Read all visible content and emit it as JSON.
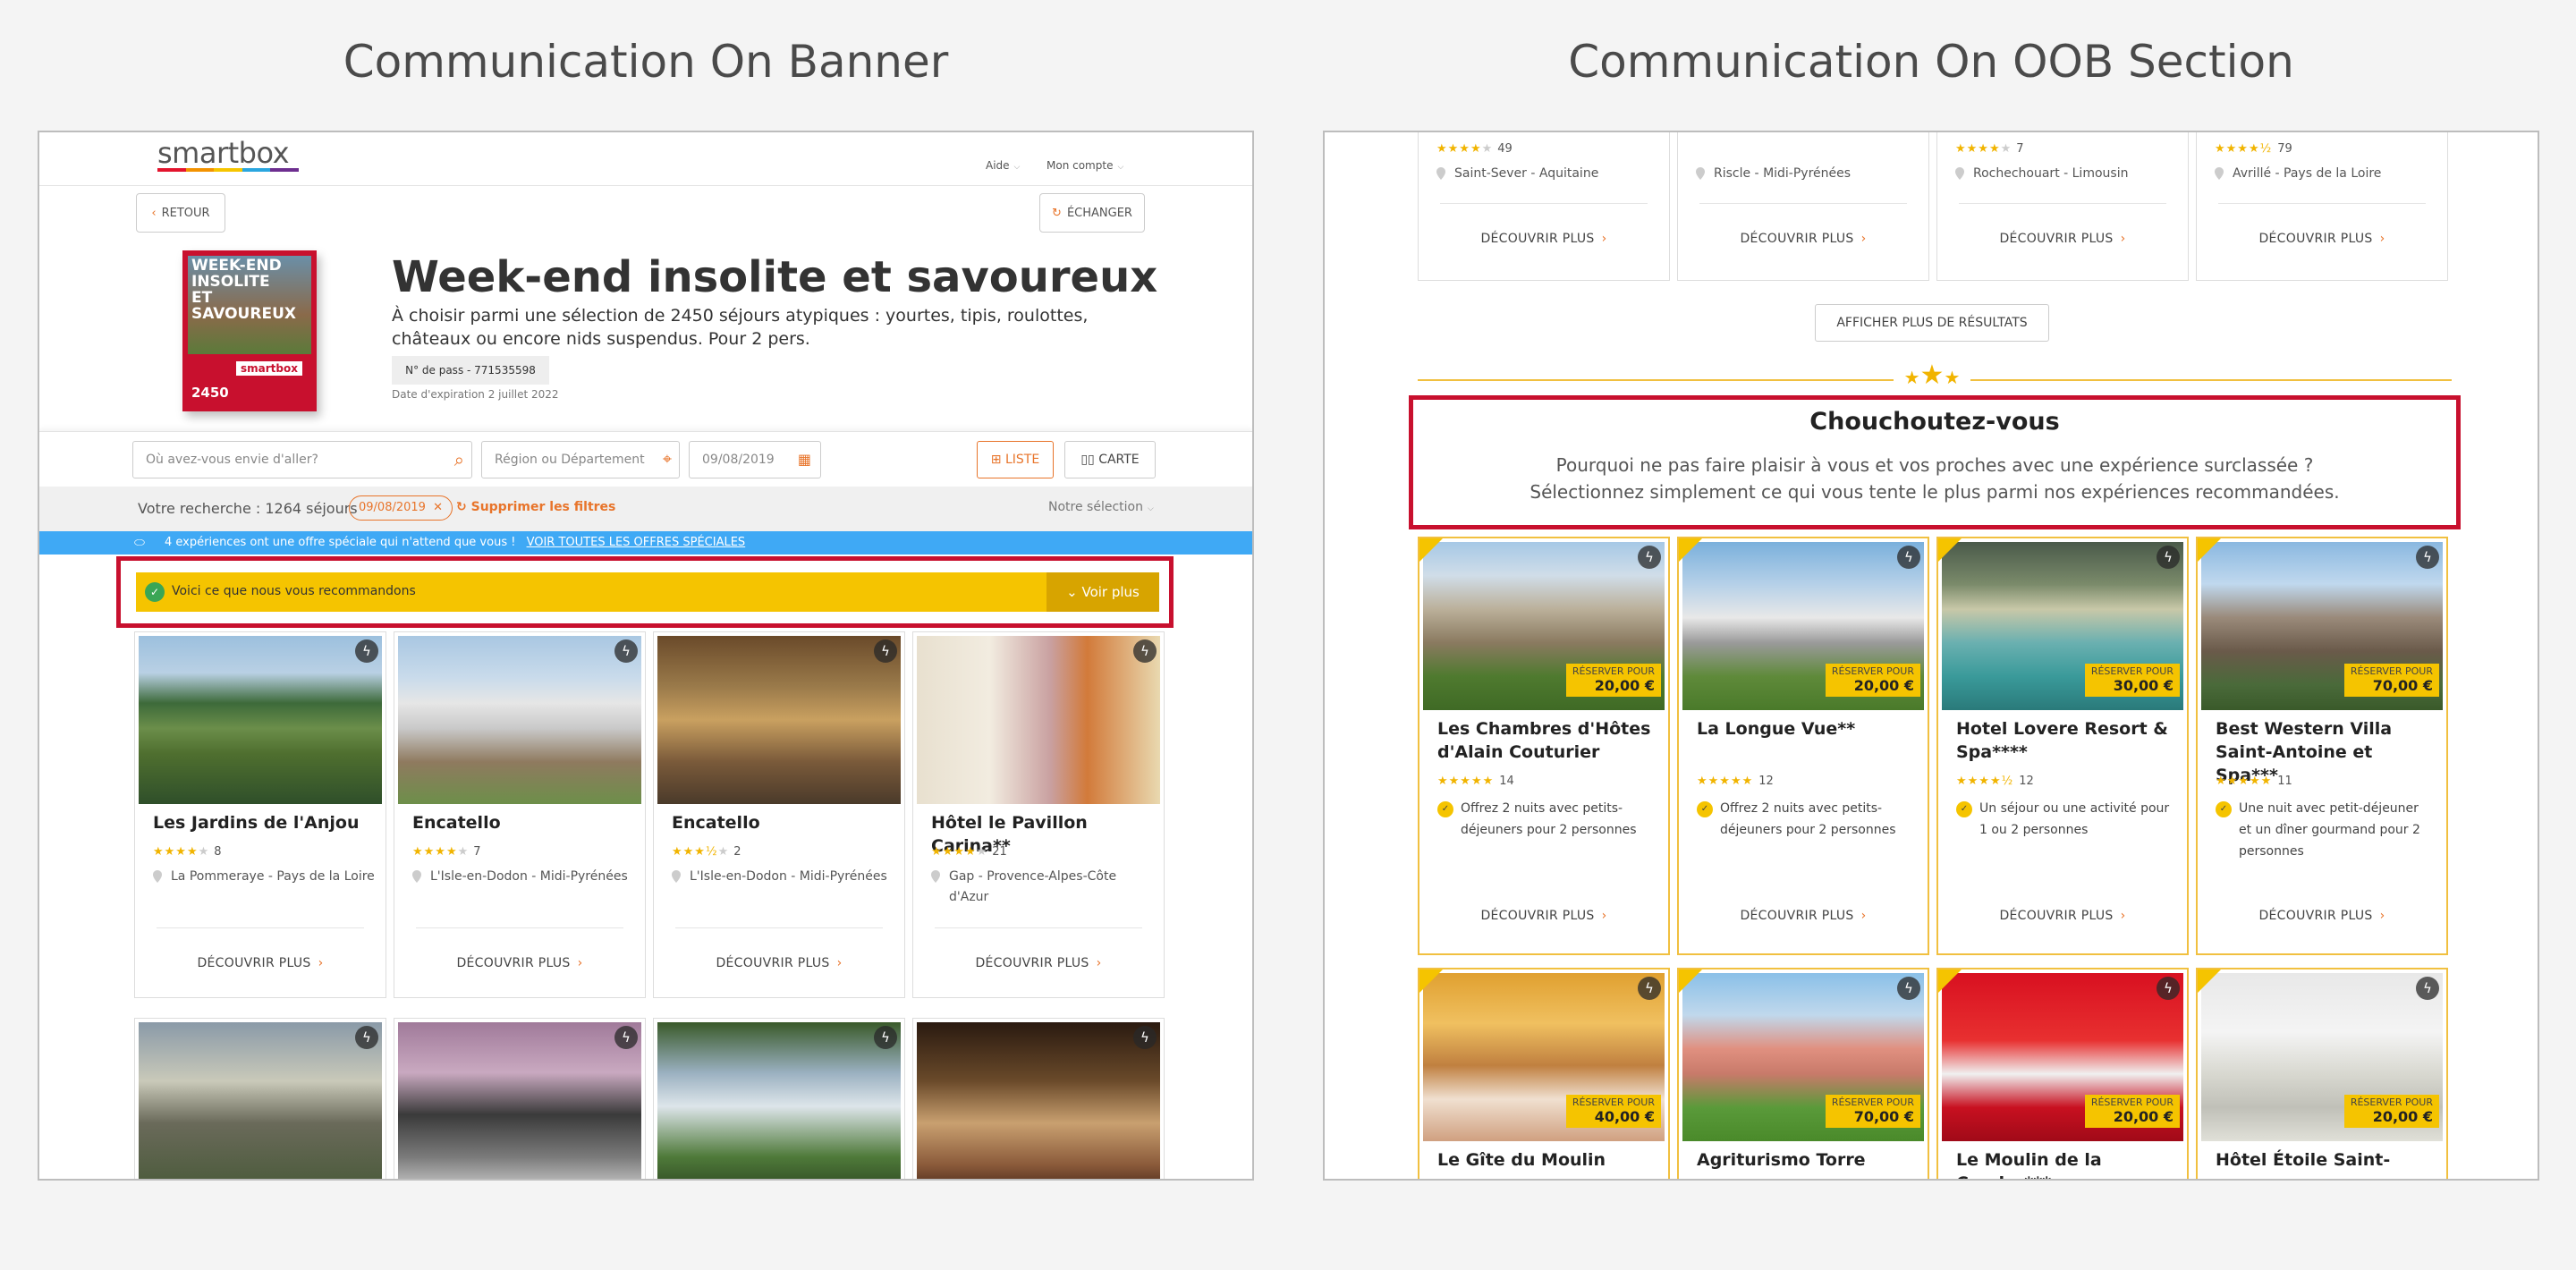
{
  "titles": {
    "left": "Communication On Banner",
    "right": "Communication On OOB Section"
  },
  "left": {
    "logo": "smartbox",
    "nav": {
      "aide": "Aide",
      "compte": "Mon compte"
    },
    "retour": "RETOUR",
    "echanger": "ÉCHANGER",
    "box": {
      "line1": "WEEK-END INSOLITE",
      "line2": "ET SAVOUREUX",
      "count": "2450",
      "brand": "smartbox"
    },
    "product": {
      "title": "Week-end insolite et savoureux",
      "desc": "À choisir parmi une sélection de 2450 séjours atypiques : yourtes, tipis, roulottes, châteaux ou encore nids suspendus. Pour 2 pers.",
      "pass": "N° de pass - 771535598",
      "expiry": "Date d'expiration 2 juillet 2022"
    },
    "search": {
      "where": "Où avez-vous envie d'aller?",
      "region": "Région ou Département",
      "date": "09/08/2019",
      "liste": "LISTE",
      "carte": "CARTE"
    },
    "results": {
      "label": "Votre recherche : 1264 séjours",
      "chip": "09/08/2019",
      "clear": "Supprimer les filtres",
      "sort": "Notre sélection"
    },
    "promo": {
      "text": "4 expériences ont une offre spéciale qui n'attend que vous !",
      "link": "VOIR TOUTES LES OFFRES SPÉCIALES"
    },
    "banner": {
      "text": "Voici ce que nous vous recommandons",
      "button": "Voir plus"
    },
    "cards": [
      {
        "title": "Les Jardins de l'Anjou",
        "rating": 4,
        "count": "8",
        "loc": "La Pommeraye - Pays de la Loire",
        "cta": "DÉCOUVRIR PLUS"
      },
      {
        "title": "Encatello",
        "rating": 4,
        "count": "7",
        "loc": "L'Isle-en-Dodon - Midi-Pyrénées",
        "cta": "DÉCOUVRIR PLUS"
      },
      {
        "title": "Encatello",
        "rating": 3.5,
        "count": "2",
        "loc": "L'Isle-en-Dodon - Midi-Pyrénées",
        "cta": "DÉCOUVRIR PLUS"
      },
      {
        "title": "Hôtel le Pavillon Carina**",
        "rating": 4,
        "count": "21",
        "loc": "Gap - Provence-Alpes-Côte d'Azur",
        "cta": "DÉCOUVRIR PLUS"
      }
    ]
  },
  "right": {
    "top_cards": [
      {
        "rating": 4,
        "count": "49",
        "loc": "Saint-Sever - Aquitaine",
        "cta": "DÉCOUVRIR PLUS"
      },
      {
        "rating": 0,
        "count": "",
        "loc": "Riscle - Midi-Pyrénées",
        "cta": "DÉCOUVRIR PLUS"
      },
      {
        "rating": 4,
        "count": "7",
        "loc": "Rochechouart - Limousin",
        "cta": "DÉCOUVRIR PLUS"
      },
      {
        "rating": 4.5,
        "count": "79",
        "loc": "Avrillé - Pays de la Loire",
        "cta": "DÉCOUVRIR PLUS"
      }
    ],
    "more": "AFFICHER PLUS DE RÉSULTATS",
    "oob": {
      "title": "Chouchoutez-vous",
      "line1": "Pourquoi ne pas faire plaisir à vous et vos proches avec une expérience surclassée ?",
      "line2": "Sélectionnez simplement ce qui vous tente le plus parmi nos expériences recommandées."
    },
    "cards": [
      {
        "title": "Les Chambres d'Hôtes d'Alain Couturier",
        "price_label": "RÉSERVER POUR",
        "price": "20,00 €",
        "rating": 5,
        "count": "14",
        "offer": "Offrez 2 nuits avec petits-déjeuners pour 2 personnes",
        "cta": "DÉCOUVRIR PLUS"
      },
      {
        "title": "La Longue Vue**",
        "price_label": "RÉSERVER POUR",
        "price": "20,00 €",
        "rating": 5,
        "count": "12",
        "offer": "Offrez 2 nuits avec petits-déjeuners pour 2 personnes",
        "cta": "DÉCOUVRIR PLUS"
      },
      {
        "title": "Hotel Lovere Resort & Spa****",
        "price_label": "RÉSERVER POUR",
        "price": "30,00 €",
        "rating": 4.5,
        "count": "12",
        "offer": "Un séjour ou une activité pour 1 ou 2 personnes",
        "cta": "DÉCOUVRIR PLUS"
      },
      {
        "title": "Best Western Villa Saint-Antoine et Spa***",
        "price_label": "RÉSERVER POUR",
        "price": "70,00 €",
        "rating": 5,
        "count": "11",
        "offer": "Une nuit avec petit-déjeuner et un dîner gourmand pour 2 personnes",
        "cta": "DÉCOUVRIR PLUS"
      }
    ],
    "cards2": [
      {
        "title": "Le Gîte du Moulin",
        "price_label": "RÉSERVER POUR",
        "price": "40,00 €"
      },
      {
        "title": "Agriturismo Torre",
        "price_label": "RÉSERVER POUR",
        "price": "70,00 €"
      },
      {
        "title": "Le Moulin de la Coudre***",
        "price_label": "RÉSERVER POUR",
        "price": "20,00 €"
      },
      {
        "title": "Hôtel Étoile Saint-",
        "price_label": "RÉSERVER POUR",
        "price": "20,00 €"
      }
    ]
  }
}
